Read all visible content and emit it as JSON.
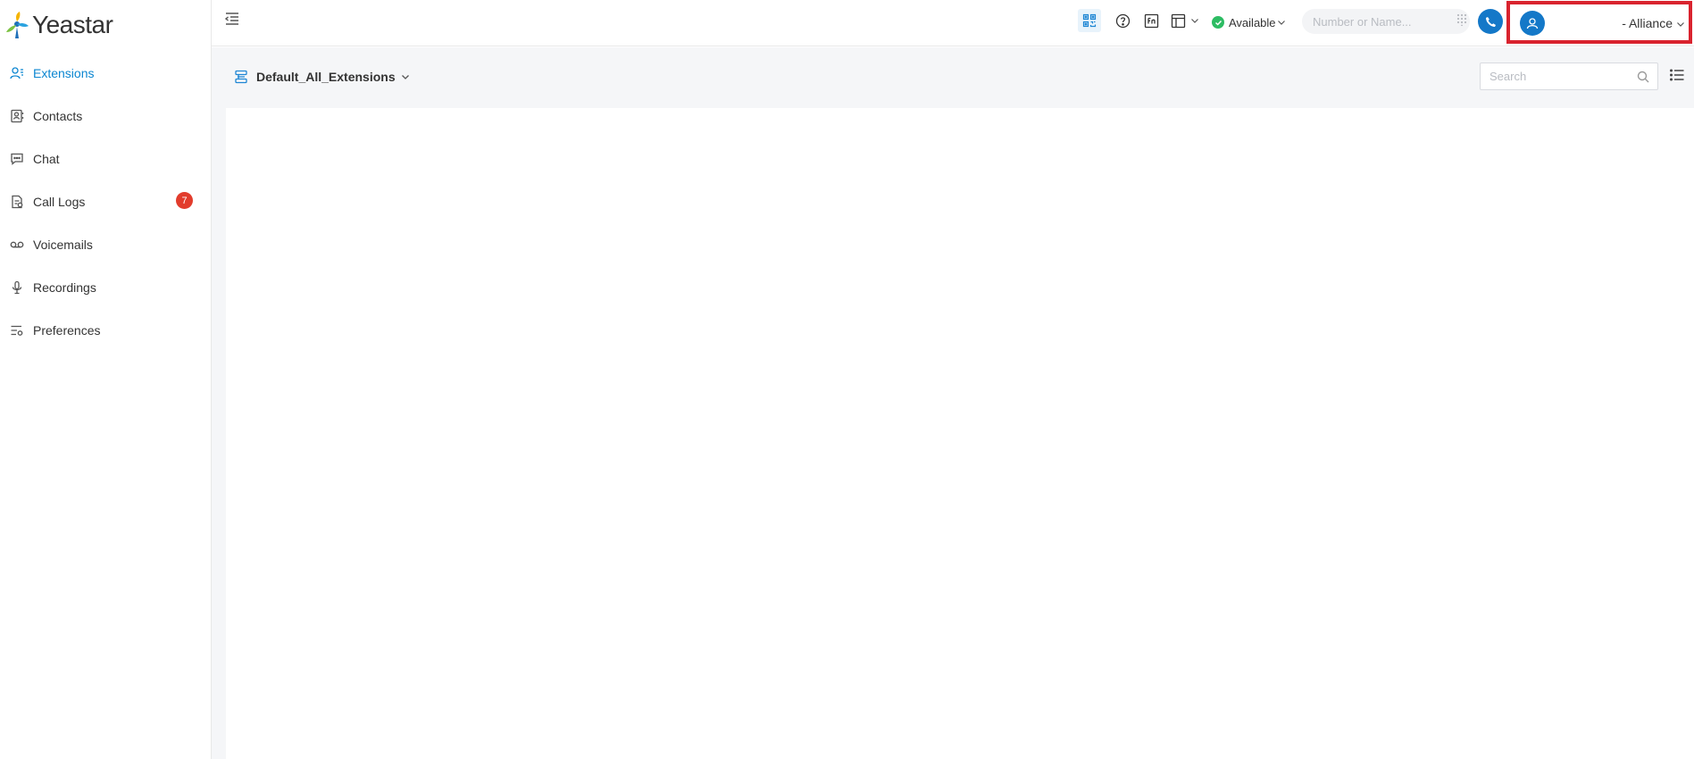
{
  "brand": {
    "name": "Yeastar"
  },
  "sidebar": {
    "items": [
      {
        "label": "Extensions",
        "icon": "extensions-icon",
        "active": true
      },
      {
        "label": "Contacts",
        "icon": "contacts-icon"
      },
      {
        "label": "Chat",
        "icon": "chat-icon"
      },
      {
        "label": "Call Logs",
        "icon": "call-logs-icon",
        "badge": "7"
      },
      {
        "label": "Voicemails",
        "icon": "voicemail-icon"
      },
      {
        "label": "Recordings",
        "icon": "microphone-icon"
      },
      {
        "label": "Preferences",
        "icon": "preferences-icon"
      }
    ]
  },
  "topbar": {
    "status_label": "Available",
    "dial_placeholder": "Number or Name...",
    "account_name": "- Alliance"
  },
  "main": {
    "group_label": "Default_All_Extensions",
    "search_placeholder": "Search"
  },
  "colors": {
    "accent": "#0b86d1",
    "badge": "#e23c2c",
    "status_green": "#2dbc63",
    "highlight_box": "#d9232e"
  }
}
